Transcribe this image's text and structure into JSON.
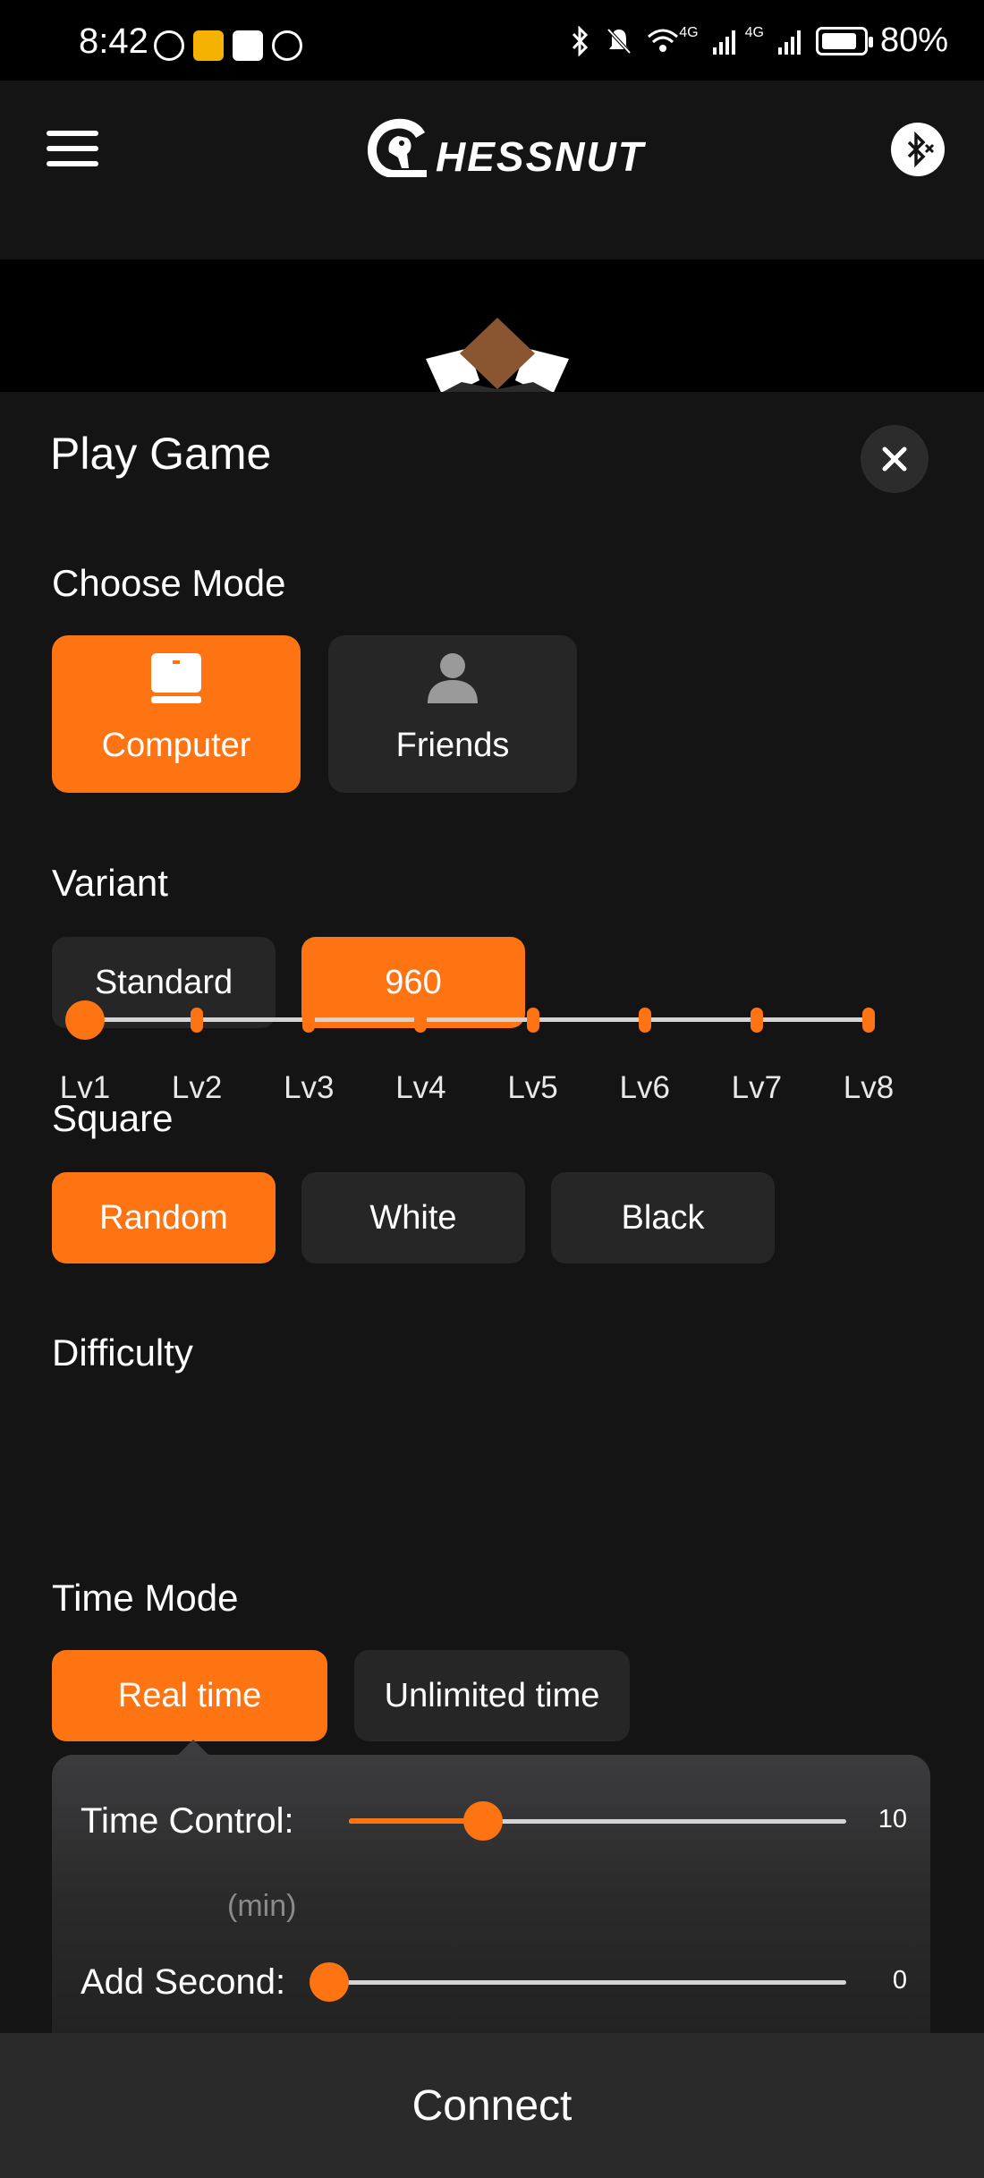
{
  "status_bar": {
    "time": "8:42",
    "battery": "80%",
    "network_1": "4G",
    "network_2": "4G"
  },
  "header": {
    "logo_text": "HESSNUT",
    "menu_icon": "hamburger-menu-icon",
    "bluetooth_icon": "bluetooth-disconnected-icon"
  },
  "sheet": {
    "title": "Play Game",
    "close_icon": "close-icon"
  },
  "choose_mode": {
    "label": "Choose Mode",
    "options": [
      {
        "label": "Computer",
        "icon": "computer-icon",
        "selected": true
      },
      {
        "label": "Friends",
        "icon": "person-icon",
        "selected": false
      }
    ]
  },
  "variant": {
    "label": "Variant",
    "options": [
      {
        "label": "Standard",
        "selected": false
      },
      {
        "label": "960",
        "selected": true
      }
    ]
  },
  "square": {
    "label": "Square",
    "options": [
      {
        "label": "Random",
        "selected": true
      },
      {
        "label": "White",
        "selected": false
      },
      {
        "label": "Black",
        "selected": false
      }
    ]
  },
  "difficulty": {
    "label": "Difficulty",
    "levels": [
      "Lv1",
      "Lv2",
      "Lv3",
      "Lv4",
      "Lv5",
      "Lv6",
      "Lv7",
      "Lv8"
    ],
    "selected_index": 0
  },
  "time_mode": {
    "label": "Time Mode",
    "options": [
      {
        "label": "Real time",
        "selected": true
      },
      {
        "label": "Unlimited time",
        "selected": false
      }
    ],
    "time_control": {
      "label": "Time Control:",
      "unit": "(min)",
      "value": "10",
      "fraction": 0.27
    },
    "add_second": {
      "label": "Add Second:",
      "value": "0",
      "fraction": 0.0
    }
  },
  "connect": {
    "label": "Connect"
  },
  "colors": {
    "accent": "#ff7412",
    "background": "#141414",
    "button": "#262626"
  }
}
